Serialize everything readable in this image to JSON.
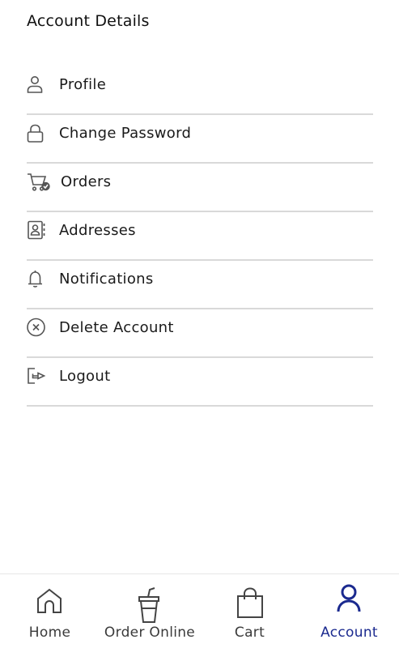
{
  "header": {
    "title": "Account Details"
  },
  "menu": {
    "items": [
      {
        "label": "Profile",
        "icon": "user-icon"
      },
      {
        "label": "Change Password",
        "icon": "lock-icon"
      },
      {
        "label": "Orders",
        "icon": "cart-check-icon"
      },
      {
        "label": "Addresses",
        "icon": "address-book-icon"
      },
      {
        "label": "Notifications",
        "icon": "bell-icon"
      },
      {
        "label": "Delete Account",
        "icon": "close-circle-icon"
      },
      {
        "label": "Logout",
        "icon": "logout-icon"
      }
    ]
  },
  "bottom_nav": {
    "items": [
      {
        "label": "Home",
        "icon": "home-icon",
        "active": false
      },
      {
        "label": "Order Online",
        "icon": "cup-icon",
        "active": false
      },
      {
        "label": "Cart",
        "icon": "shopping-bag-icon",
        "active": false
      },
      {
        "label": "Account",
        "icon": "user-icon",
        "active": true
      }
    ]
  },
  "colors": {
    "active_nav": "#1b2a8f",
    "icon_gray": "#555555",
    "divider": "#d9d9d9"
  }
}
